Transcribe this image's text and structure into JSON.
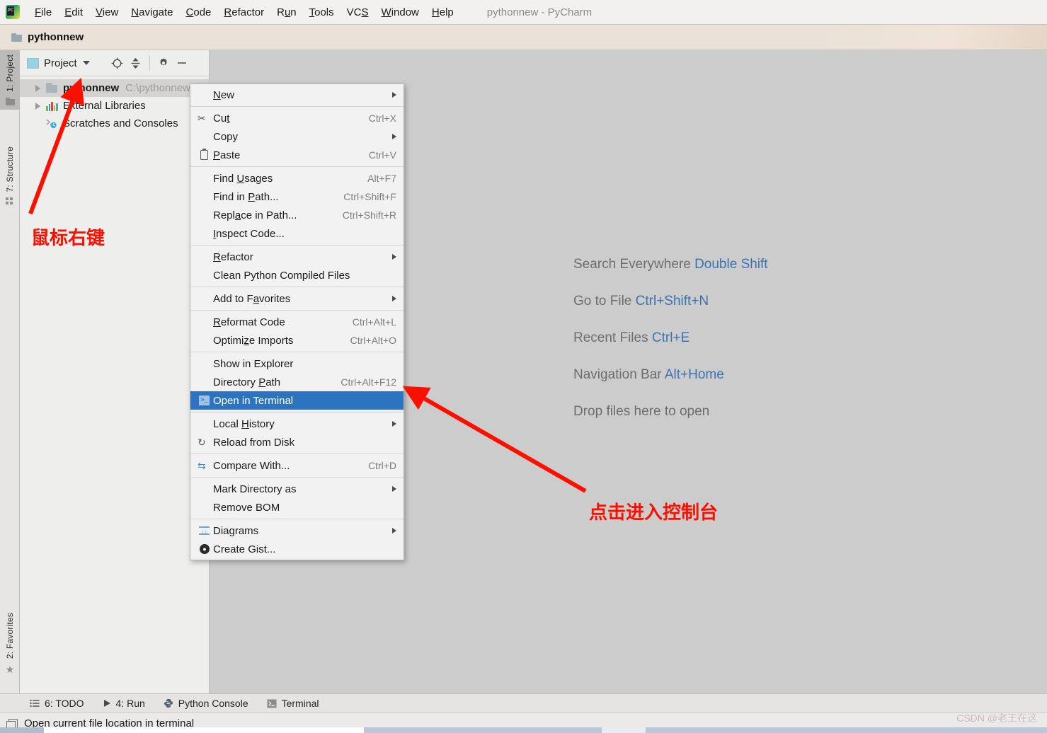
{
  "window": {
    "title": "pythonnew - PyCharm",
    "logo_text": "PC"
  },
  "menubar": {
    "items": [
      {
        "label": "File",
        "mnemonic": "F"
      },
      {
        "label": "Edit",
        "mnemonic": "E"
      },
      {
        "label": "View",
        "mnemonic": "V"
      },
      {
        "label": "Navigate",
        "mnemonic": "N"
      },
      {
        "label": "Code",
        "mnemonic": "C"
      },
      {
        "label": "Refactor",
        "mnemonic": "R"
      },
      {
        "label": "Run",
        "mnemonic": "u"
      },
      {
        "label": "Tools",
        "mnemonic": "T"
      },
      {
        "label": "VCS",
        "mnemonic": "S"
      },
      {
        "label": "Window",
        "mnemonic": "W"
      },
      {
        "label": "Help",
        "mnemonic": "H"
      }
    ]
  },
  "breadcrumb": {
    "label": "pythonnew",
    "icon": "folder-icon"
  },
  "toolstrip": {
    "left_top": [
      {
        "label": "1: Project",
        "icon": "folder-icon",
        "active": true
      },
      {
        "label": "7: Structure",
        "icon": "structure-icon",
        "active": false
      }
    ],
    "left_bottom": [
      {
        "label": "2: Favorites",
        "icon": "star-icon",
        "active": false
      }
    ]
  },
  "project_panel": {
    "header": {
      "title": "Project",
      "caret": "chevron-down-icon",
      "buttons": [
        "locate-icon",
        "collapse-all-icon",
        "settings-gear-icon",
        "hide-icon"
      ]
    },
    "tree": [
      {
        "name": "pythonnew",
        "path": "C:\\pythonnew",
        "icon": "folder-icon",
        "expandable": true,
        "selected": true,
        "bold": true,
        "indent": 0
      },
      {
        "name": "External Libraries",
        "path": "",
        "icon": "library-icon",
        "expandable": true,
        "selected": false,
        "bold": false,
        "indent": 0
      },
      {
        "name": "Scratches and Consoles",
        "path": "",
        "icon": "scratches-icon",
        "expandable": false,
        "selected": false,
        "bold": false,
        "indent": 0
      }
    ]
  },
  "editor_hints": [
    {
      "text": "Search Everywhere ",
      "key": "Double Shift"
    },
    {
      "text": "Go to File ",
      "key": "Ctrl+Shift+N"
    },
    {
      "text": "Recent Files ",
      "key": "Ctrl+E"
    },
    {
      "text": "Navigation Bar ",
      "key": "Alt+Home"
    },
    {
      "text": "Drop files here to open",
      "key": ""
    }
  ],
  "context_menu": {
    "items": [
      {
        "type": "item",
        "label": "New",
        "accel": "",
        "icon": "",
        "submenu": true,
        "selected": false
      },
      {
        "type": "sep"
      },
      {
        "type": "item",
        "label": "Cut",
        "accel": "Ctrl+X",
        "icon": "scissors-icon",
        "submenu": false,
        "selected": false
      },
      {
        "type": "item",
        "label": "Copy",
        "accel": "",
        "icon": "",
        "submenu": true,
        "selected": false
      },
      {
        "type": "item",
        "label": "Paste",
        "accel": "Ctrl+V",
        "icon": "clipboard-icon",
        "submenu": false,
        "selected": false
      },
      {
        "type": "sep"
      },
      {
        "type": "item",
        "label": "Find Usages",
        "accel": "Alt+F7",
        "icon": "",
        "submenu": false,
        "selected": false
      },
      {
        "type": "item",
        "label": "Find in Path...",
        "accel": "Ctrl+Shift+F",
        "icon": "",
        "submenu": false,
        "selected": false
      },
      {
        "type": "item",
        "label": "Replace in Path...",
        "accel": "Ctrl+Shift+R",
        "icon": "",
        "submenu": false,
        "selected": false
      },
      {
        "type": "item",
        "label": "Inspect Code...",
        "accel": "",
        "icon": "",
        "submenu": false,
        "selected": false
      },
      {
        "type": "sep"
      },
      {
        "type": "item",
        "label": "Refactor",
        "accel": "",
        "icon": "",
        "submenu": true,
        "selected": false
      },
      {
        "type": "item",
        "label": "Clean Python Compiled Files",
        "accel": "",
        "icon": "",
        "submenu": false,
        "selected": false
      },
      {
        "type": "sep"
      },
      {
        "type": "item",
        "label": "Add to Favorites",
        "accel": "",
        "icon": "",
        "submenu": true,
        "selected": false
      },
      {
        "type": "sep"
      },
      {
        "type": "item",
        "label": "Reformat Code",
        "accel": "Ctrl+Alt+L",
        "icon": "",
        "submenu": false,
        "selected": false
      },
      {
        "type": "item",
        "label": "Optimize Imports",
        "accel": "Ctrl+Alt+O",
        "icon": "",
        "submenu": false,
        "selected": false
      },
      {
        "type": "sep"
      },
      {
        "type": "item",
        "label": "Show in Explorer",
        "accel": "",
        "icon": "",
        "submenu": false,
        "selected": false
      },
      {
        "type": "item",
        "label": "Directory Path",
        "accel": "Ctrl+Alt+F12",
        "icon": "",
        "submenu": false,
        "selected": false
      },
      {
        "type": "item",
        "label": "Open in Terminal",
        "accel": "",
        "icon": "terminal-icon",
        "submenu": false,
        "selected": true
      },
      {
        "type": "sep"
      },
      {
        "type": "item",
        "label": "Local History",
        "accel": "",
        "icon": "",
        "submenu": true,
        "selected": false
      },
      {
        "type": "item",
        "label": "Reload from Disk",
        "accel": "",
        "icon": "reload-icon",
        "submenu": false,
        "selected": false
      },
      {
        "type": "sep"
      },
      {
        "type": "item",
        "label": "Compare With...",
        "accel": "Ctrl+D",
        "icon": "compare-icon",
        "submenu": false,
        "selected": false
      },
      {
        "type": "sep"
      },
      {
        "type": "item",
        "label": "Mark Directory as",
        "accel": "",
        "icon": "",
        "submenu": true,
        "selected": false
      },
      {
        "type": "item",
        "label": "Remove BOM",
        "accel": "",
        "icon": "",
        "submenu": false,
        "selected": false
      },
      {
        "type": "sep"
      },
      {
        "type": "item",
        "label": "Diagrams",
        "accel": "",
        "icon": "diagram-icon",
        "submenu": true,
        "selected": false
      },
      {
        "type": "item",
        "label": "Create Gist...",
        "accel": "",
        "icon": "github-icon",
        "submenu": false,
        "selected": false
      }
    ]
  },
  "bottom_bar": {
    "items": [
      {
        "label": "6: TODO",
        "icon": "todo-list-icon"
      },
      {
        "label": "4: Run",
        "icon": "run-play-icon"
      },
      {
        "label": "Python Console",
        "icon": "python-icon"
      },
      {
        "label": "Terminal",
        "icon": "terminal-icon"
      }
    ]
  },
  "status_bar": {
    "text": "Open current file location in terminal",
    "icon": "windows-copy-icon"
  },
  "annotations": [
    {
      "id": "anno1",
      "text": "鼠标右键",
      "color": "#fb1000"
    },
    {
      "id": "anno2",
      "text": "点击进入控制台",
      "color": "#fb1000"
    }
  ],
  "watermark": {
    "text": "CSDN @老王在这"
  },
  "colors": {
    "selection_blue": "#2c74c0",
    "editor_bg": "#cccccc",
    "panel_bg": "#eeeeec",
    "menu_bg": "#f2f2f2",
    "annotation_red": "#fb1000",
    "hint_key_blue": "#3b72b0"
  }
}
